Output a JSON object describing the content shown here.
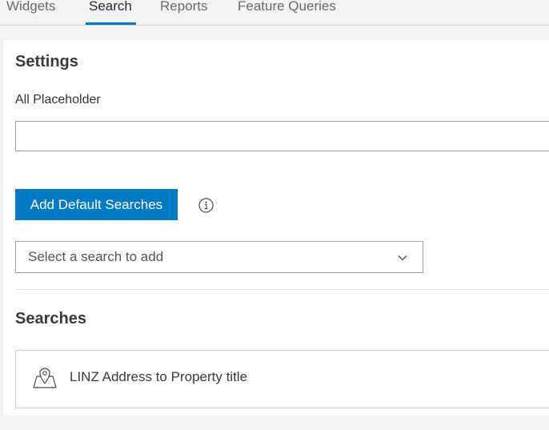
{
  "tabs": [
    {
      "label": "Widgets"
    },
    {
      "label": "Search"
    },
    {
      "label": "Reports"
    },
    {
      "label": "Feature Queries"
    }
  ],
  "active_tab": "Search",
  "settings": {
    "title": "Settings",
    "placeholder_label": "All Placeholder",
    "placeholder_value": "",
    "add_default_button": "Add Default Searches",
    "info_icon": "info-icon",
    "select_search": {
      "selected_text": "Select a search to add",
      "icon": "chevron-down-icon"
    }
  },
  "searches": {
    "title": "Searches",
    "items": [
      {
        "label": "LINZ Address to Property title",
        "icon": "map-pin-icon"
      }
    ]
  },
  "colors": {
    "accent": "#007ac2",
    "background": "#f3f3f3",
    "panel": "#ffffff"
  }
}
